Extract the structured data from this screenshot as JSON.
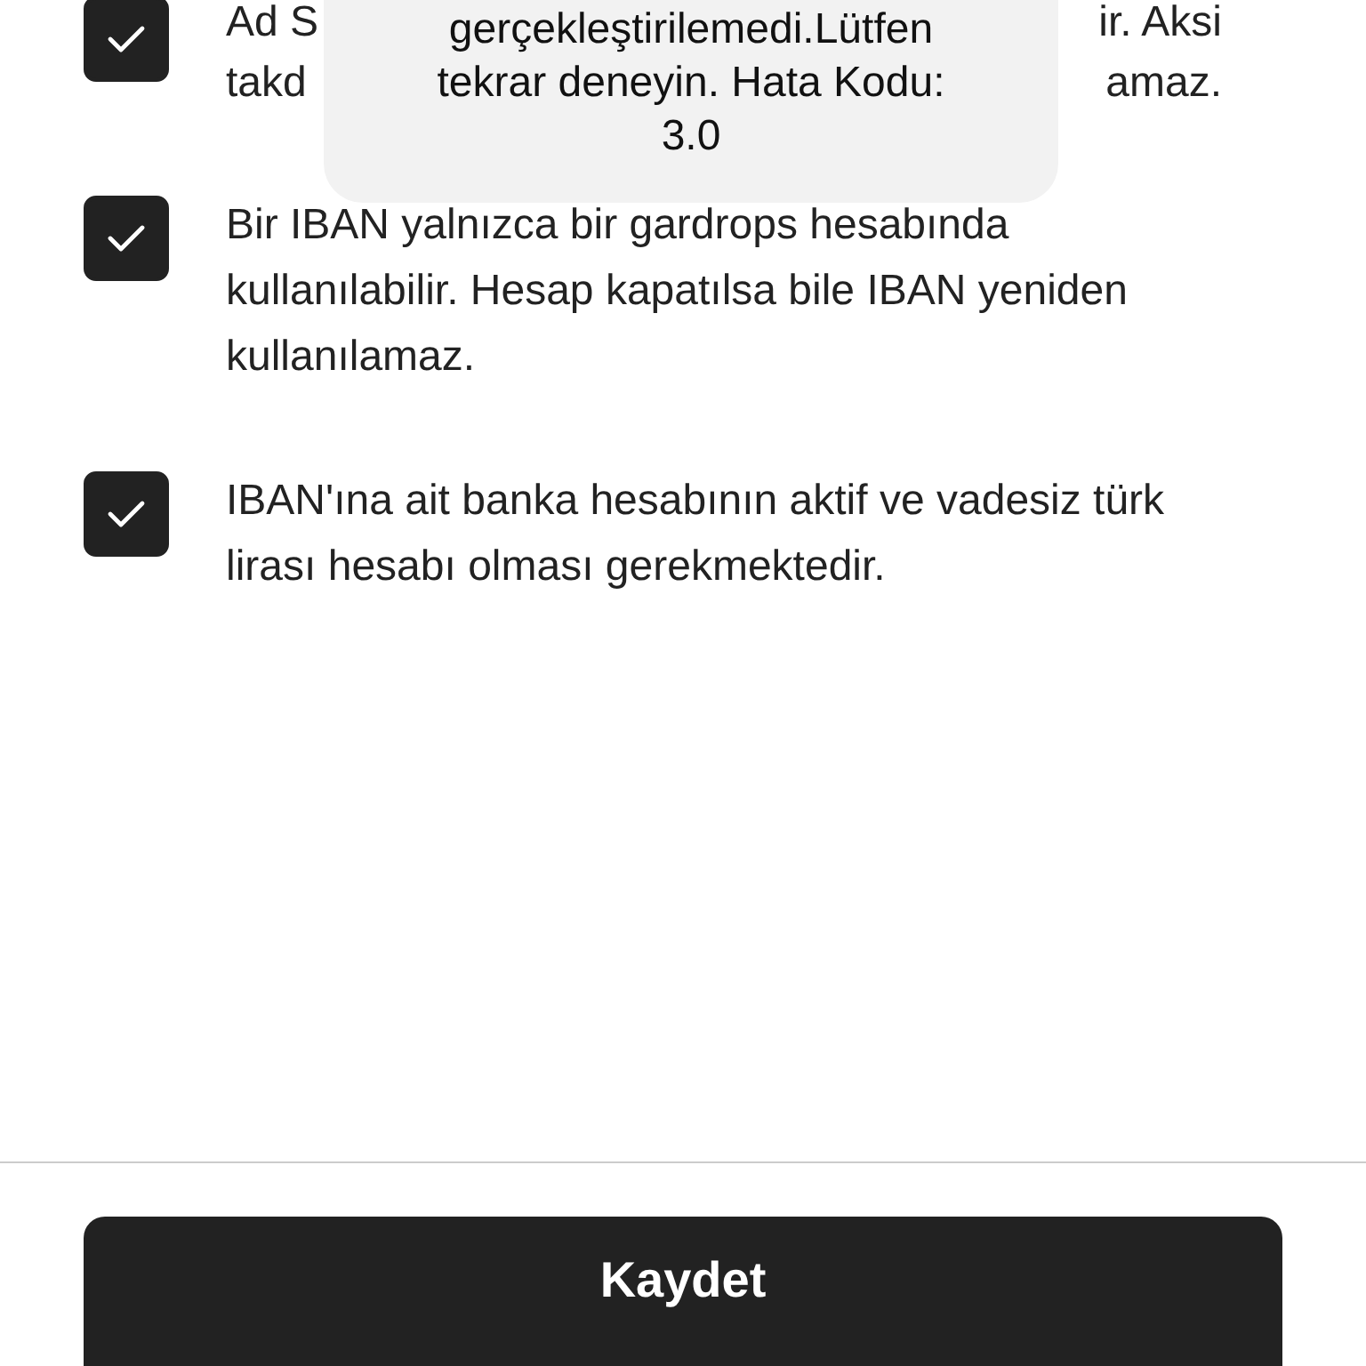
{
  "items": [
    {
      "kind": "obscured",
      "checked": true,
      "left_lines": [
        "Ad S",
        "takd"
      ],
      "right_lines": [
        "ir. Aksi",
        "amaz."
      ]
    },
    {
      "kind": "plain",
      "checked": true,
      "text": "Bir IBAN yalnızca bir gardrops hesabında kullanılabilir. Hesap kapatılsa bile IBAN yeniden kullanılamaz."
    },
    {
      "kind": "plain",
      "checked": true,
      "text": "IBAN'ına ait banka hesabının aktif ve vadesiz türk lirası hesabı olması gerekmektedir."
    }
  ],
  "toast": {
    "lines": [
      "gerçekleştirilemedi.Lütfen",
      "tekrar deneyin. Hata Kodu:",
      "3.0"
    ]
  },
  "save_button": {
    "label": "Kaydet"
  }
}
